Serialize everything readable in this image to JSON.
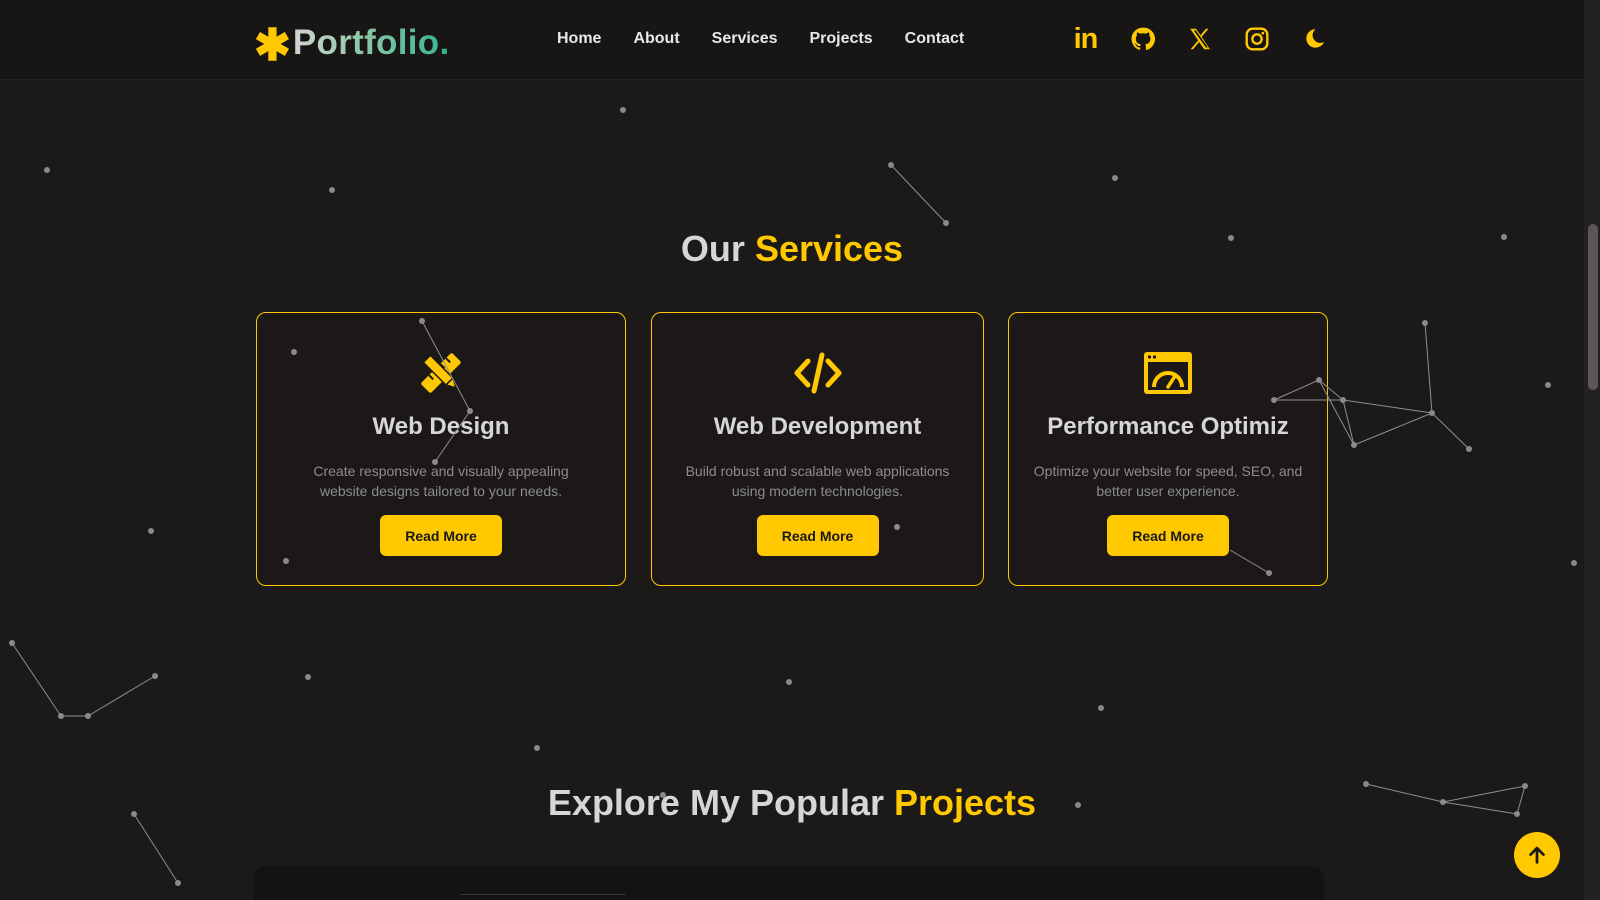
{
  "header": {
    "logo_star": "✱",
    "logo_text": "Portfolio",
    "logo_dot": ".",
    "nav": [
      "Home",
      "About",
      "Services",
      "Projects",
      "Contact"
    ],
    "socials": [
      "linkedin-icon",
      "github-icon",
      "x-icon",
      "instagram-icon",
      "moon-icon"
    ],
    "linkedin_text": "in"
  },
  "colors": {
    "accent": "#ffc800",
    "background": "#1c1919",
    "logo_gradient_end": "#2fb38f"
  },
  "services": {
    "title_plain": "Our",
    "title_accent": "Services",
    "cards": [
      {
        "icon": "pencil-ruler-icon",
        "title": "Web Design",
        "description": "Create responsive and visually appealing website designs tailored to your needs.",
        "button": "Read More"
      },
      {
        "icon": "code-icon",
        "title": "Web Development",
        "description": "Build robust and scalable web applications using modern technologies.",
        "button": "Read More"
      },
      {
        "icon": "speedometer-window-icon",
        "title": "Performance Optimiz",
        "description": "Optimize your website for speed, SEO, and better user experience.",
        "button": "Read More"
      }
    ]
  },
  "projects": {
    "title_plain": "Explore My Popular",
    "title_accent": "Projects"
  },
  "scroll_top": "arrow-up-icon"
}
